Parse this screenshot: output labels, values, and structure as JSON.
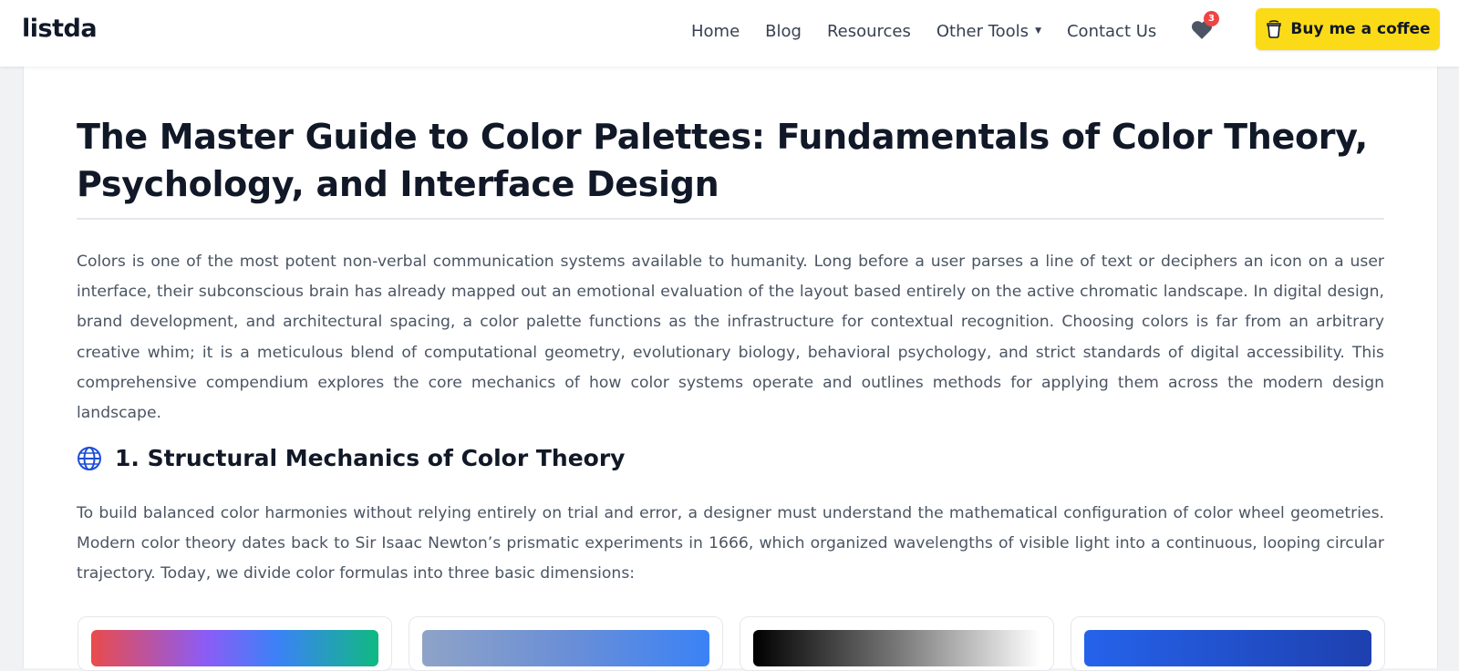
{
  "header": {
    "logo": "listda",
    "nav": [
      "Home",
      "Blog",
      "Resources",
      "Other Tools",
      "Contact Us"
    ],
    "favorites_count": "3",
    "cta_label": "Buy me a coffee"
  },
  "article": {
    "title": "The Master Guide to Color Palettes: Fundamentals of Color Theory, Psychology, and Interface Design",
    "intro": "Colors is one of the most potent non-verbal communication systems available to humanity. Long before a user parses a line of text or deciphers an icon on a user interface, their subconscious brain has already mapped out an emotional evaluation of the layout based entirely on the active chromatic landscape. In digital design, brand development, and architectural spacing, a color palette functions as the infrastructure for contextual recognition. Choosing colors is far from an arbitrary creative whim; it is a meticulous blend of computational geometry, evolutionary biology, behavioral psychology, and strict standards of digital accessibility. This comprehensive compendium explores the core mechanics of how color systems operate and outlines methods for applying them across the modern design landscape.",
    "section1": {
      "icon": "globe-icon",
      "title": "1. Structural Mechanics of Color Theory",
      "body": "To build balanced color harmonies without relying entirely on trial and error, a designer must understand the mathematical configuration of color wheel geometries. Modern color theory dates back to Sir Isaac Newton’s prismatic experiments in 1666, which organized wavelengths of visible light into a continuous, looping circular trajectory. Today, we divide color formulas into three basic dimensions:"
    }
  },
  "colors": {
    "cta_bg": "#fbdb18",
    "badge": "#ef4444",
    "accent": "#1d4ed8"
  },
  "cards": [
    {
      "gradient": "linear-gradient(90deg, #e94b4b 0%, #8b5cf6 40%, #3b82f6 65%, #10b981 100%)"
    },
    {
      "gradient": "linear-gradient(90deg, #8ea3c7 0%, #6b8fd6 50%, #3b82f6 100%)"
    },
    {
      "gradient": "linear-gradient(90deg, #000000 0%, #777777 50%, #ffffff 100%)"
    },
    {
      "gradient": "linear-gradient(90deg, #2563eb 0%, #1e40af 100%)"
    }
  ]
}
